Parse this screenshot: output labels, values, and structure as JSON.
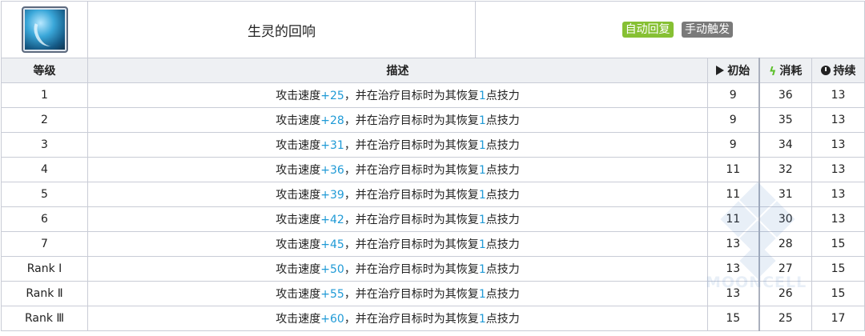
{
  "skill": {
    "name": "生灵的回响",
    "icon": "skill-icon",
    "tags": {
      "auto": "自动回复",
      "manual": "手动触发"
    }
  },
  "columns": {
    "level": "等级",
    "desc": "描述",
    "initial": "初始",
    "cost": "消耗",
    "duration": "持续"
  },
  "rows": [
    {
      "level": "1",
      "prefix": "攻击速度",
      "value": "+25",
      "mid": "，并在治疗目标时为其恢复",
      "amount": "1",
      "suffix": "点技力",
      "initial": "9",
      "cost": "36",
      "duration": "13"
    },
    {
      "level": "2",
      "prefix": "攻击速度",
      "value": "+28",
      "mid": "，并在治疗目标时为其恢复",
      "amount": "1",
      "suffix": "点技力",
      "initial": "9",
      "cost": "35",
      "duration": "13"
    },
    {
      "level": "3",
      "prefix": "攻击速度",
      "value": "+31",
      "mid": "，并在治疗目标时为其恢复",
      "amount": "1",
      "suffix": "点技力",
      "initial": "9",
      "cost": "34",
      "duration": "13"
    },
    {
      "level": "4",
      "prefix": "攻击速度",
      "value": "+36",
      "mid": "，并在治疗目标时为其恢复",
      "amount": "1",
      "suffix": "点技力",
      "initial": "11",
      "cost": "32",
      "duration": "13"
    },
    {
      "level": "5",
      "prefix": "攻击速度",
      "value": "+39",
      "mid": "，并在治疗目标时为其恢复",
      "amount": "1",
      "suffix": "点技力",
      "initial": "11",
      "cost": "31",
      "duration": "13"
    },
    {
      "level": "6",
      "prefix": "攻击速度",
      "value": "+42",
      "mid": "，并在治疗目标时为其恢复",
      "amount": "1",
      "suffix": "点技力",
      "initial": "11",
      "cost": "30",
      "duration": "13"
    },
    {
      "level": "7",
      "prefix": "攻击速度",
      "value": "+45",
      "mid": "，并在治疗目标时为其恢复",
      "amount": "1",
      "suffix": "点技力",
      "initial": "13",
      "cost": "28",
      "duration": "15"
    },
    {
      "level": "Rank Ⅰ",
      "prefix": "攻击速度",
      "value": "+50",
      "mid": "，并在治疗目标时为其恢复",
      "amount": "1",
      "suffix": "点技力",
      "initial": "13",
      "cost": "27",
      "duration": "15"
    },
    {
      "level": "Rank Ⅱ",
      "prefix": "攻击速度",
      "value": "+55",
      "mid": "，并在治疗目标时为其恢复",
      "amount": "1",
      "suffix": "点技力",
      "initial": "13",
      "cost": "26",
      "duration": "15"
    },
    {
      "level": "Rank Ⅲ",
      "prefix": "攻击速度",
      "value": "+60",
      "mid": "，并在治疗目标时为其恢复",
      "amount": "1",
      "suffix": "点技力",
      "initial": "15",
      "cost": "25",
      "duration": "17"
    }
  ],
  "watermark": "MOONCELL",
  "colors": {
    "highlight": "#1f9ad6",
    "tag_auto": "#86c033",
    "tag_manual": "#7a7a7a"
  }
}
